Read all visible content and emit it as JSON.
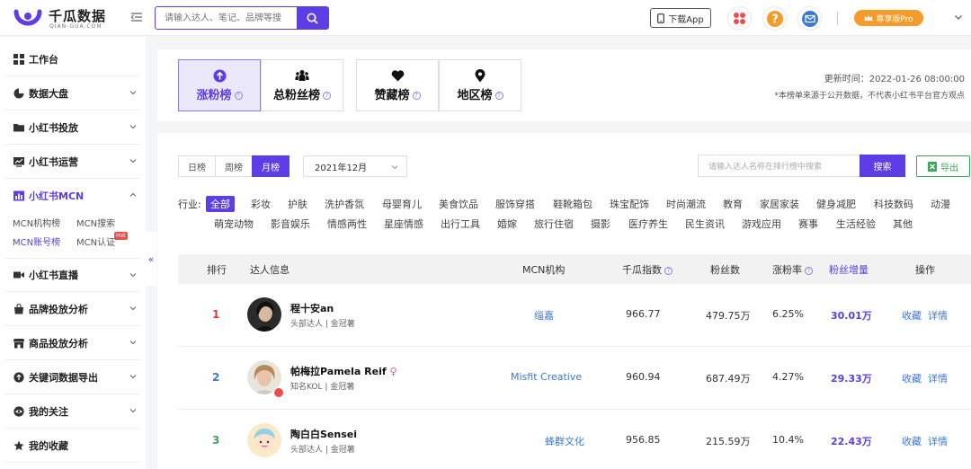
{
  "app": {
    "name": "千瓜数据",
    "name_en": "QIAN-GUA.COM",
    "brand_color": "#5b3ee6"
  },
  "topbar": {
    "search_placeholder": "请输入达人、笔记、品牌等搜",
    "download_label": "下载App",
    "pro_label": "尊享版Pro"
  },
  "sidebar": {
    "items": [
      {
        "label": "工作台",
        "icon": "grid-icon"
      },
      {
        "label": "数据大盘",
        "icon": "pie-chart-icon"
      },
      {
        "label": "小红书投放",
        "icon": "folder-icon"
      },
      {
        "label": "小红书运营",
        "icon": "chart-monitor-icon"
      },
      {
        "label": "小红书MCN",
        "icon": "bar-chart-icon"
      },
      {
        "label": "小红书直播",
        "icon": "video-icon"
      },
      {
        "label": "品牌投放分析",
        "icon": "bag-icon"
      },
      {
        "label": "商品投放分析",
        "icon": "shop-icon"
      },
      {
        "label": "关键词数据导出",
        "icon": "export-icon"
      },
      {
        "label": "我的关注",
        "icon": "eye-icon"
      },
      {
        "label": "我的收藏",
        "icon": "star-icon"
      }
    ],
    "mcn_sub": [
      "MCN机构榜",
      "MCN搜索",
      "MCN账号榜",
      "MCN认证"
    ],
    "hot_badge": "Hot"
  },
  "boards": {
    "tabs": [
      "涨粉榜",
      "总粉丝榜",
      "赞藏榜",
      "地区榜"
    ],
    "update_time": "更新时间：2022-01-26 08:00:00",
    "disclaimer": "*本榜单来源于公开数据，不代表小红书平台官方观点"
  },
  "filters": {
    "periods": [
      "日榜",
      "周榜",
      "月榜"
    ],
    "month": "2021年12月",
    "rank_search_placeholder": "请输入达人名称在排行榜中搜索",
    "search_label": "搜索",
    "export_label": "导出",
    "industry_label": "行业:",
    "industries": [
      "全部",
      "彩妆",
      "护肤",
      "洗护香氛",
      "母婴育儿",
      "美食饮品",
      "服饰穿搭",
      "鞋靴箱包",
      "珠宝配饰",
      "时尚潮流",
      "教育",
      "家居家装",
      "健身减肥",
      "科技数码",
      "动漫",
      "萌宠动物",
      "影音娱乐",
      "情感两性",
      "星座情感",
      "出行工具",
      "婚嫁",
      "旅行住宿",
      "摄影",
      "医疗养生",
      "民生资讯",
      "游戏应用",
      "赛事",
      "生活经验",
      "其他"
    ]
  },
  "table": {
    "headers": [
      "排行",
      "达人信息",
      "MCN机构",
      "千瓜指数",
      "粉丝数",
      "涨粉率",
      "粉丝增量",
      "操作"
    ],
    "rows": [
      {
        "rank": "1",
        "rank_color": "#e03b3b",
        "name": "程十安an",
        "tag": "头部达人 | 金冠薯",
        "mcn": "缁嘉",
        "index": "966.77",
        "fans": "479.75万",
        "rate": "6.25%",
        "gain": "30.01万",
        "op1": "收藏",
        "op2": "详情"
      },
      {
        "rank": "2",
        "rank_color": "#3a78d8",
        "name": "帕梅拉Pamela Reif",
        "tag": "知名KOL | 金冠薯",
        "mcn": "Misfit Creative",
        "index": "960.94",
        "fans": "687.49万",
        "rate": "4.27%",
        "gain": "29.33万",
        "op1": "收藏",
        "op2": "详情"
      },
      {
        "rank": "3",
        "rank_color": "#3aa85c",
        "name": "陶白白Sensei",
        "tag": "头部达人 | 金冠薯",
        "mcn": "蜂群文化",
        "index": "956.85",
        "fans": "215.59万",
        "rate": "10.4%",
        "gain": "22.43万",
        "op1": "收藏",
        "op2": "详情"
      }
    ]
  }
}
